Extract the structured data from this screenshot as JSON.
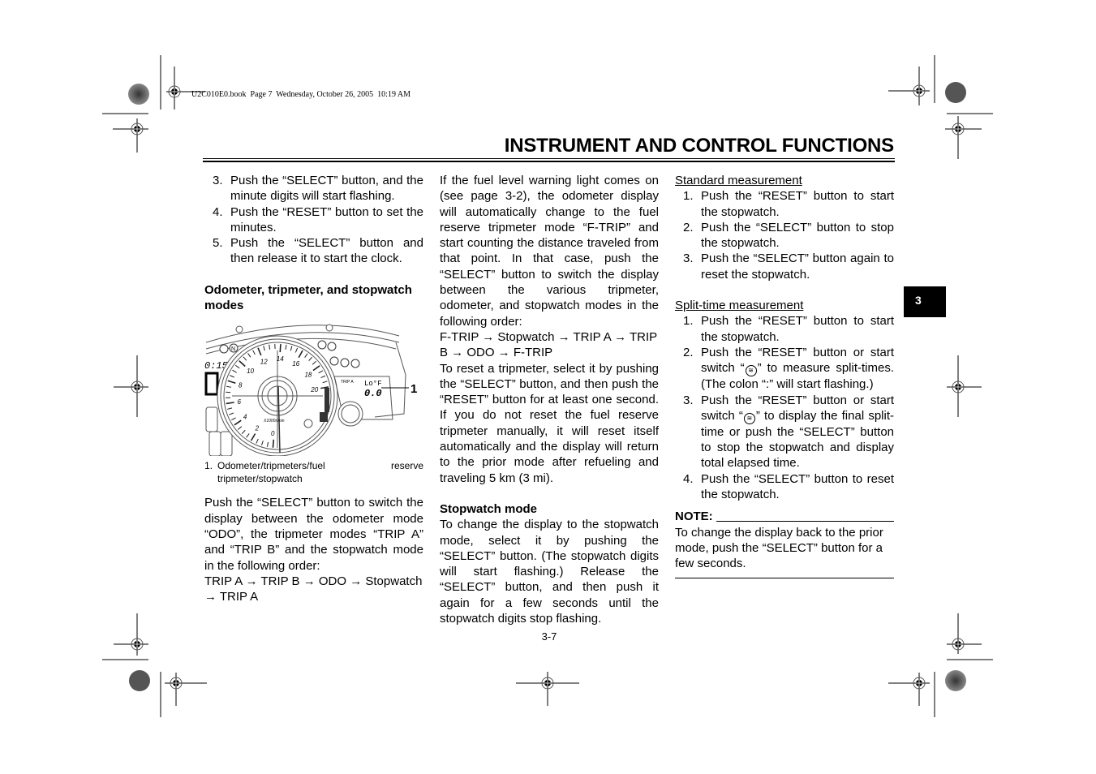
{
  "header": {
    "meta": "U2C010E0.book  Page 7  Wednesday, October 26, 2005  10:19 AM",
    "title": "INSTRUMENT AND CONTROL FUNCTIONS"
  },
  "chapter_tab": "3",
  "page_number": "3-7",
  "col1": {
    "steps": [
      {
        "num": "3.",
        "text": "Push the “SELECT” button, and the minute digits will start flashing."
      },
      {
        "num": "4.",
        "text": "Push the “RESET” button to set the minutes."
      },
      {
        "num": "5.",
        "text": "Push the “SELECT” button and then release it to start the clock."
      }
    ],
    "heading": "Odometer, tripmeter, and stopwatch modes",
    "figure": {
      "callout_number": "1",
      "gauge_labels": [
        "0",
        "2",
        "4",
        "6",
        "8",
        "10",
        "12",
        "14",
        "16",
        "18",
        "20"
      ],
      "unit_label": "X1000r/min",
      "clock_display": "0:15",
      "gear_display": "0",
      "trip_label": "TRIP A",
      "lcd_top": "Lo°F",
      "lcd_value": "0.0"
    },
    "caption_num": "1.",
    "caption": "Odometer/tripmeters/fuel reserve tripmeter/stopwatch",
    "para1": "Push the “SELECT” button to switch the display between the odometer mode “ODO”, the tripmeter modes “TRIP A” and “TRIP B” and the stopwatch mode in the following order:",
    "sequence": "TRIP A → TRIP B → ODO → Stopwatch → TRIP A"
  },
  "col2": {
    "para1": "If the fuel level warning light comes on (see page 3-2), the odometer display will automatically change to the fuel reserve tripmeter mode “F-TRIP” and start counting the distance traveled from that point. In that case, push the “SELECT” button to switch the display between the various tripmeter, odometer, and stopwatch modes in the following order:",
    "sequence": "F-TRIP → Stopwatch → TRIP A → TRIP B → ODO → F-TRIP",
    "para2": "To reset a tripmeter, select it by pushing the “SELECT” button, and then push the “RESET” button for at least one second. If you do not reset the fuel reserve tripmeter manually, it will reset itself automatically and the display will return to the prior mode after refueling and traveling 5 km (3 mi).",
    "heading": "Stopwatch mode",
    "para3": "To change the display to the stopwatch mode, select it by pushing the “SELECT” button. (The stopwatch digits will start flashing.) Release the “SELECT” button, and then push it again for a few seconds until the stopwatch digits stop flashing."
  },
  "col3": {
    "standard": {
      "heading": "Standard measurement",
      "steps": [
        {
          "num": "1.",
          "text": "Push the “RESET” button to start the stopwatch."
        },
        {
          "num": "2.",
          "text": "Push the “SELECT” button to stop the stopwatch."
        },
        {
          "num": "3.",
          "text": "Push the “SELECT” button again to reset the stopwatch."
        }
      ]
    },
    "split": {
      "heading": "Split-time measurement",
      "step1": "Push the “RESET” button to start the stopwatch.",
      "step2_a": "Push the “RESET” button or start switch “",
      "step2_b": "” to measure split-times. (The colon “:” will start flashing.)",
      "step3_a": "Push the “RESET” button or start switch “",
      "step3_b": "” to display the final split-time or push the “SELECT” button to stop the stopwatch and display total elapsed time.",
      "step4": "Push the “SELECT” button to reset the stopwatch.",
      "nums": [
        "1.",
        "2.",
        "3.",
        "4."
      ],
      "icon_glyph": "≋"
    },
    "note": {
      "label": "NOTE:",
      "text": "To change the display back to the prior mode, push the “SELECT” button for a few seconds."
    }
  }
}
